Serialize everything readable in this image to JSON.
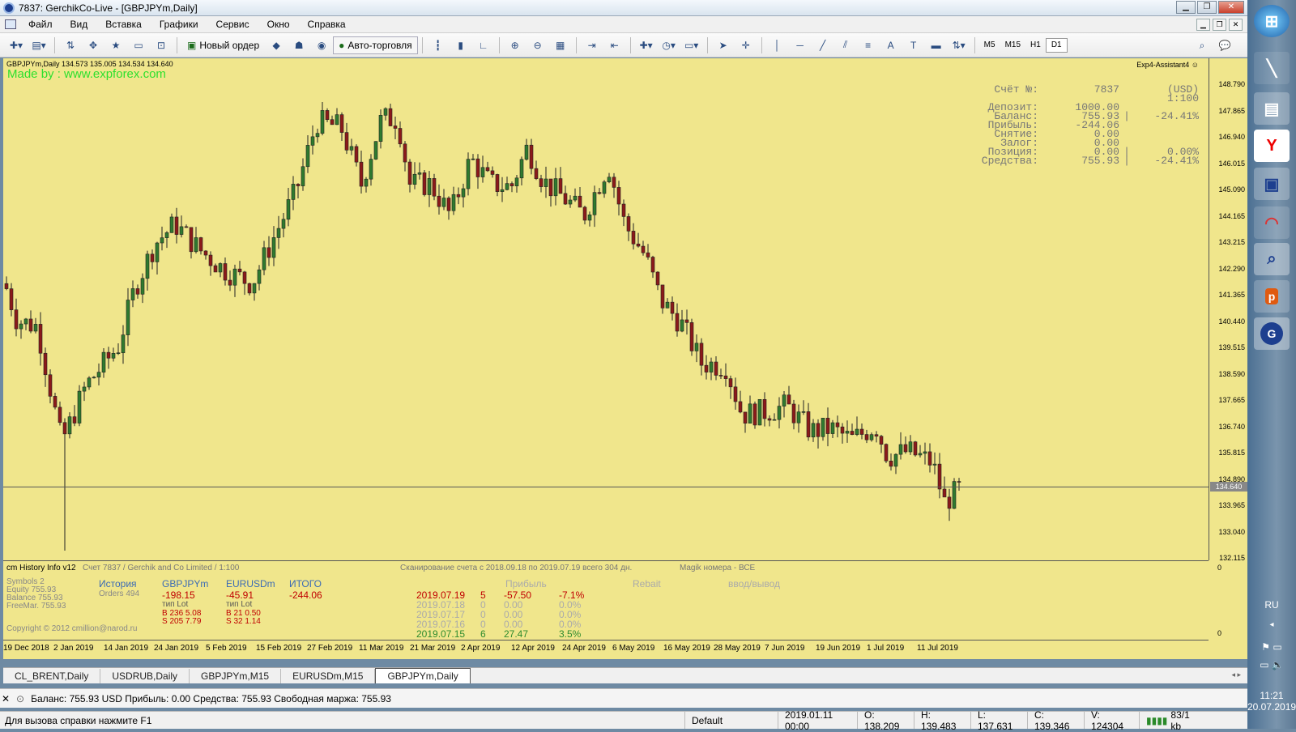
{
  "window": {
    "title": "7837: GerchikCo-Live - [GBPJPYm,Daily]"
  },
  "menu": [
    "Файл",
    "Вид",
    "Вставка",
    "Графики",
    "Сервис",
    "Окно",
    "Справка"
  ],
  "toolbar": {
    "new_order": "Новый ордер",
    "autotrade": "Авто-торговля",
    "timeframes": [
      "M5",
      "M15",
      "H1",
      "D1"
    ],
    "active_tf": "D1"
  },
  "chart": {
    "symbol_header": "GBPJPYm,Daily  134.573 135.005 134.534 134.640",
    "made_by": "Made by : www.expforex.com",
    "expert": "Exp4-Assistant4 ☺",
    "current_price": "134.640",
    "price_ticks": [
      "148.790",
      "147.865",
      "146.940",
      "146.015",
      "145.090",
      "144.165",
      "143.215",
      "142.290",
      "141.365",
      "140.440",
      "139.515",
      "138.590",
      "137.665",
      "136.740",
      "135.815",
      "134.890",
      "133.965",
      "133.040",
      "132.115"
    ],
    "dates": [
      "19 Dec 2018",
      "2 Jan 2019",
      "14 Jan 2019",
      "24 Jan 2019",
      "5 Feb 2019",
      "15 Feb 2019",
      "27 Feb 2019",
      "11 Mar 2019",
      "21 Mar 2019",
      "2 Apr 2019",
      "12 Apr 2019",
      "24 Apr 2019",
      "6 May 2019",
      "16 May 2019",
      "28 May 2019",
      "7 Jun 2019",
      "19 Jun 2019",
      "1 Jul 2019",
      "11 Jul 2019"
    ],
    "colors": {
      "bg": "#f0e68c",
      "bull": "#2f7a2f",
      "bear": "#8b1a1a",
      "wick": "#222222"
    }
  },
  "account": [
    {
      "k": "Счёт №:",
      "v": "7837",
      "s": "",
      "p": "(USD) 1:100"
    },
    {
      "k": "Депозит:",
      "v": "1000.00",
      "s": "",
      "p": ""
    },
    {
      "k": "Баланс:",
      "v": "755.93",
      "s": "|",
      "p": "-24.41%"
    },
    {
      "k": "Прибыль:",
      "v": "-244.06",
      "s": "",
      "p": ""
    },
    {
      "k": "Снятие:",
      "v": "0.00",
      "s": "",
      "p": ""
    },
    {
      "k": "Залог:",
      "v": "0.00",
      "s": "",
      "p": ""
    },
    {
      "k": "Позиция:",
      "v": "0.00",
      "s": "|",
      "p": "0.00%"
    },
    {
      "k": "Средства:",
      "v": "755.93",
      "s": "|",
      "p": "-24.41%"
    }
  ],
  "history": {
    "name": "cm History Info v12",
    "account": "Счет 7837 / Gerchik and Co Limited / 1:100",
    "scan": "Сканирование счета с 2018.09.18 по 2019.07.19 всего 304 дн.",
    "magic": "Magik номера - ВСЕ",
    "axis_top": "0",
    "axis_bottom": "0",
    "stats": [
      "Symbols  2",
      "Equity   755.93",
      "Balance  755.93",
      "FreeMar.  755.93"
    ],
    "hist_label": "История",
    "orders": "Orders 494",
    "copyright": "Copyright © 2012 cmillion@narod.ru",
    "symbols": [
      {
        "name": "GBPJPYm",
        "profit": "-198.15",
        "head": "тип   Lot",
        "b": "B 236    5.08",
        "s": "S 205    7.79"
      },
      {
        "name": "EURUSDm",
        "profit": "-45.91",
        "head": "тип   Lot",
        "b": "B 21    0.50",
        "s": "S 32    1.14"
      },
      {
        "name": "ИТОГО",
        "profit": "-244.06",
        "head": "",
        "b": "",
        "s": ""
      }
    ],
    "col_profit": "Прибыль",
    "col_rebait": "Rebait",
    "col_io": "ввод/вывод",
    "days": [
      {
        "d": "2019.07.19",
        "n": "5",
        "p": "-57.50",
        "pc": "-7.1%",
        "c": "red"
      },
      {
        "d": "2019.07.18",
        "n": "0",
        "p": "0.00",
        "pc": "0.0%",
        "c": "gray"
      },
      {
        "d": "2019.07.17",
        "n": "0",
        "p": "0.00",
        "pc": "0.0%",
        "c": "gray"
      },
      {
        "d": "2019.07.16",
        "n": "0",
        "p": "0.00",
        "pc": "0.0%",
        "c": "gray"
      },
      {
        "d": "2019.07.15",
        "n": "6",
        "p": "27.47",
        "pc": "3.5%",
        "c": "green"
      }
    ]
  },
  "tabs": [
    "CL_BRENT,Daily",
    "USDRUB,Daily",
    "GBPJPYm,M15",
    "EURUSDm,M15",
    "GBPJPYm,Daily"
  ],
  "active_tab": "GBPJPYm,Daily",
  "terminal": "Баланс: 755.93 USD  Прибыль: 0.00  Средства: 755.93  Свободная маржа: 755.93",
  "status": {
    "help": "Для вызова справки нажмите F1",
    "profile": "Default",
    "time": "2019.01.11 00:00",
    "o": "O: 138.209",
    "h": "H: 139.483",
    "l": "L: 137.631",
    "c": "C: 139.346",
    "v": "V: 124304",
    "traffic": "83/1 kb"
  },
  "taskbar": {
    "lang": "RU",
    "time": "11:21",
    "date": "20.07.2019"
  }
}
